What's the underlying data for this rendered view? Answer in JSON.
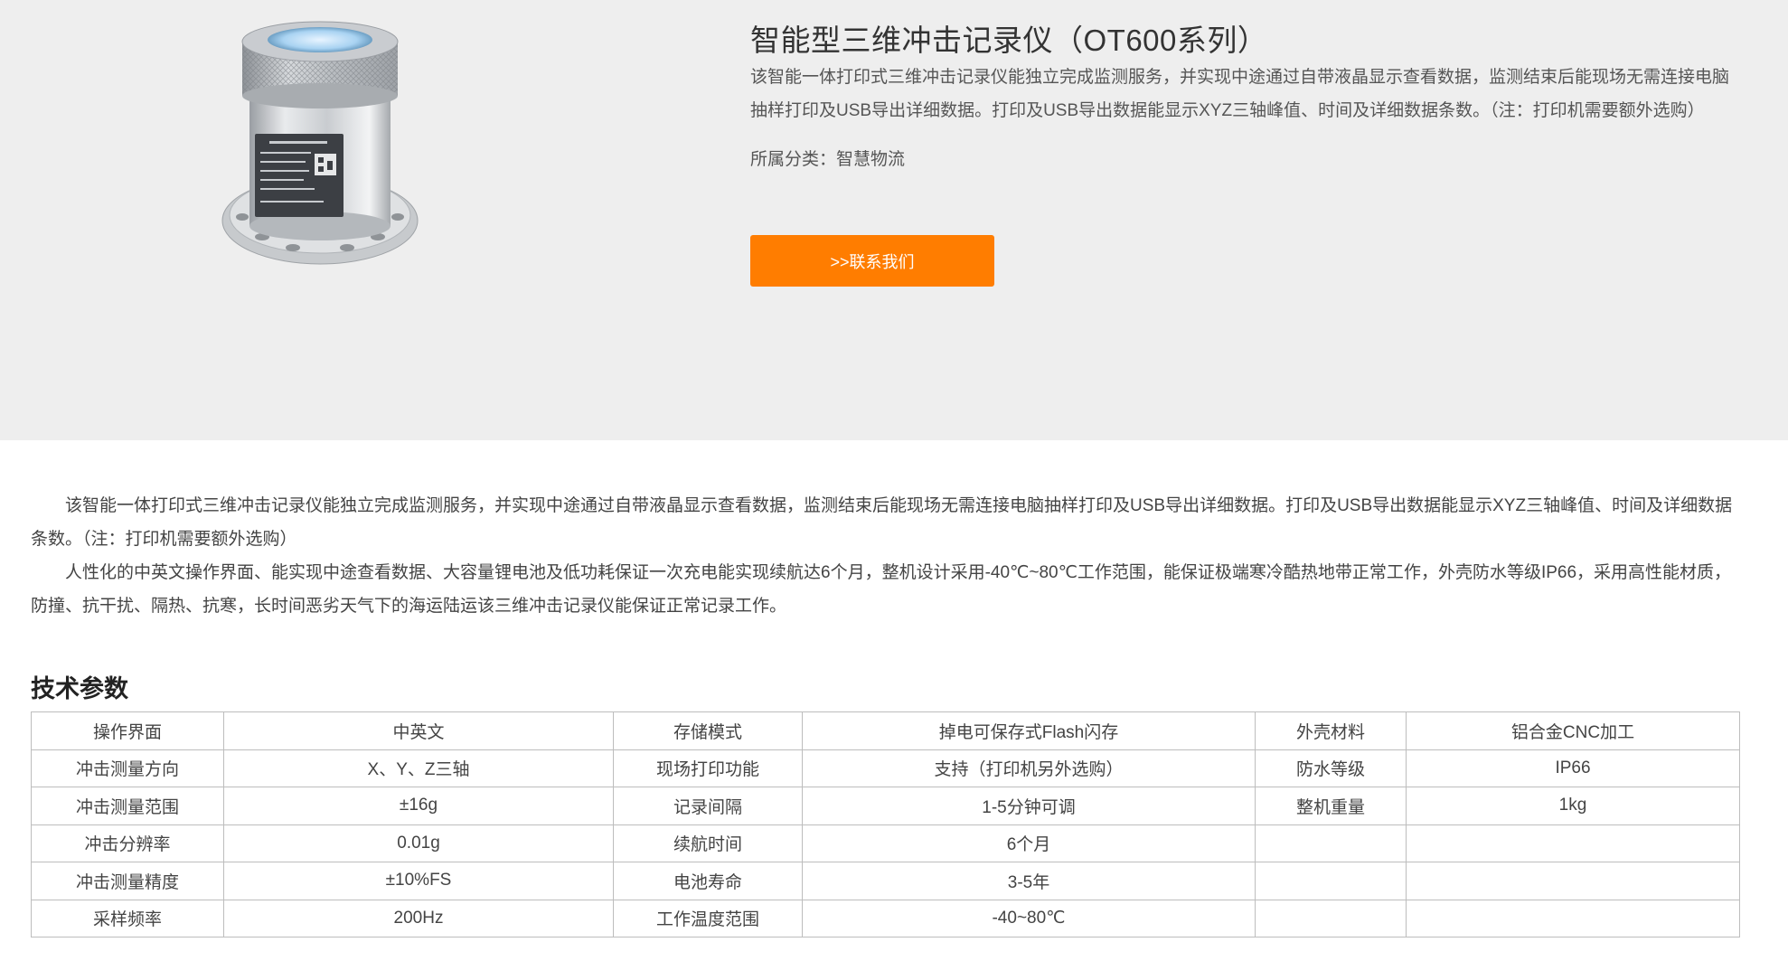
{
  "product": {
    "title": "智能型三维冲击记录仪（OT600系列）",
    "summary": "该智能一体打印式三维冲击记录仪能独立完成监测服务，并实现中途通过自带液晶显示查看数据，监测结束后能现场无需连接电脑抽样打印及USB导出详细数据。打印及USB导出数据能显示XYZ三轴峰值、时间及详细数据条数。（注：打印机需要额外选购）",
    "category_label": "所属分类：",
    "category_value": "智慧物流",
    "contact_button": ">>联系我们"
  },
  "description": {
    "paragraphs": [
      "该智能一体打印式三维冲击记录仪能独立完成监测服务，并实现中途通过自带液晶显示查看数据，监测结束后能现场无需连接电脑抽样打印及USB导出详细数据。打印及USB导出数据能显示XYZ三轴峰值、时间及详细数据条数。（注：打印机需要额外选购）",
      "人性化的中英文操作界面、能实现中途查看数据、大容量锂电池及低功耗保证一次充电能实现续航达6个月，整机设计采用-40℃~80℃工作范围，能保证极端寒冷酷热地带正常工作，外壳防水等级IP66，采用高性能材质，防撞、抗干扰、隔热、抗寒，长时间恶劣天气下的海运陆运该三维冲击记录仪能保证正常记录工作。"
    ]
  },
  "specs": {
    "title": "技术参数",
    "rows": [
      [
        "操作界面",
        "中英文",
        "存储模式",
        "掉电可保存式Flash闪存",
        "外壳材料",
        "铝合金CNC加工"
      ],
      [
        "冲击测量方向",
        "X、Y、Z三轴",
        "现场打印功能",
        "支持（打印机另外选购）",
        "防水等级",
        "IP66"
      ],
      [
        "冲击测量范围",
        "±16g",
        "记录间隔",
        "1-5分钟可调",
        "整机重量",
        "1kg"
      ],
      [
        "冲击分辨率",
        "0.01g",
        "续航时间",
        "6个月",
        "",
        ""
      ],
      [
        "冲击测量精度",
        "±10%FS",
        "电池寿命",
        "3-5年",
        "",
        ""
      ],
      [
        "采样频率",
        "200Hz",
        "工作温度范围",
        "-40~80℃",
        "",
        ""
      ]
    ]
  },
  "colors": {
    "hero_bg": "#eeeeee",
    "accent": "#ff7d00",
    "table_border": "#bdbdbd"
  },
  "icons": {
    "product_image": "shock-recorder-device-image"
  }
}
